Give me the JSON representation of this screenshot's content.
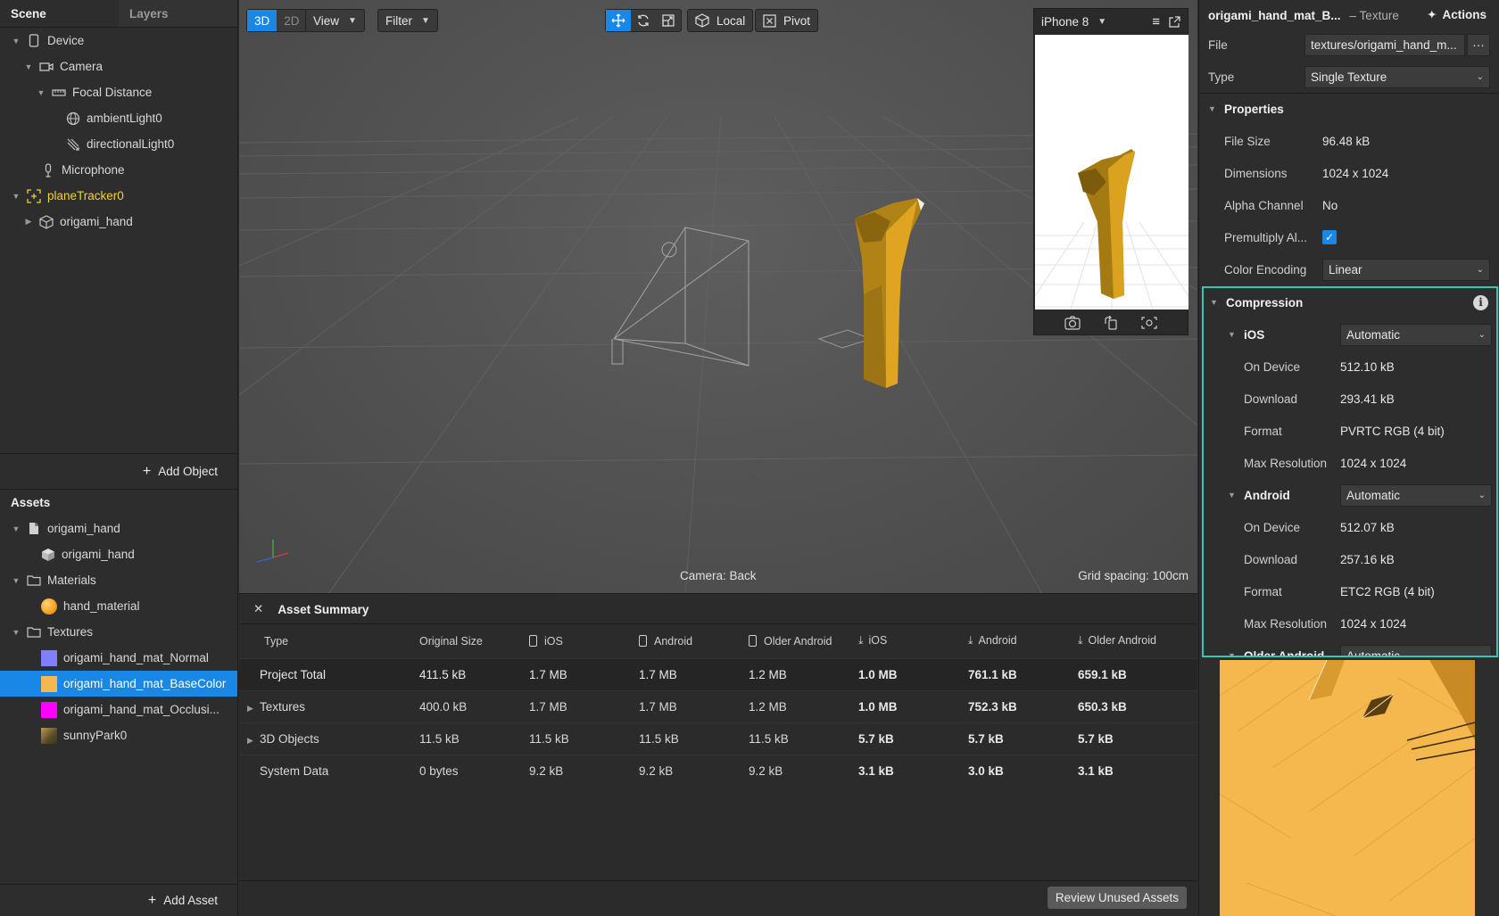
{
  "scene_tabs": {
    "scene": "Scene",
    "layers": "Layers"
  },
  "scene_tree": [
    {
      "label": "Device",
      "icon": "device-icon",
      "indent": 0,
      "expanded": true
    },
    {
      "label": "Camera",
      "icon": "camera-icon",
      "indent": 1,
      "expanded": true
    },
    {
      "label": "Focal Distance",
      "icon": "focal-distance-icon",
      "indent": 2,
      "expanded": true
    },
    {
      "label": "ambientLight0",
      "icon": "ambient-light-icon",
      "indent": 3
    },
    {
      "label": "directionalLight0",
      "icon": "directional-light-icon",
      "indent": 3
    },
    {
      "label": "Microphone",
      "icon": "microphone-icon",
      "indent": 1
    },
    {
      "label": "planeTracker0",
      "icon": "plane-tracker-icon",
      "indent": 0,
      "expanded": true,
      "highlight": "#f4d42a"
    },
    {
      "label": "origami_hand",
      "icon": "mesh-icon",
      "indent": 1,
      "collapsed": true
    }
  ],
  "add_object": "Add Object",
  "assets_title": "Assets",
  "assets_tree": [
    {
      "label": "origami_hand",
      "icon": "file-icon",
      "indent": 0,
      "expanded": true
    },
    {
      "label": "origami_hand",
      "icon": "mesh-icon",
      "indent": 1
    },
    {
      "label": "Materials",
      "icon": "folder-icon",
      "indent": 0,
      "expanded": true
    },
    {
      "label": "hand_material",
      "icon": "material-sphere-icon",
      "indent": 1,
      "color": "#f5a623"
    },
    {
      "label": "Textures",
      "icon": "folder-icon",
      "indent": 0,
      "expanded": true
    },
    {
      "label": "origami_hand_mat_Normal",
      "icon": "texture-swatch-icon",
      "indent": 1,
      "color": "#8080ff"
    },
    {
      "label": "origami_hand_mat_BaseColor",
      "icon": "texture-swatch-icon",
      "indent": 1,
      "color": "#f4b84f",
      "selected": true
    },
    {
      "label": "origami_hand_mat_Occlusi...",
      "icon": "texture-swatch-icon",
      "indent": 1,
      "color": "#ff00ff"
    },
    {
      "label": "sunnyPark0",
      "icon": "env-texture-icon",
      "indent": 1,
      "color": "#7a6a3a"
    }
  ],
  "add_asset": "Add Asset",
  "toolbar": {
    "mode_3d": "3D",
    "mode_2d": "2D",
    "view": "View",
    "filter": "Filter",
    "local": "Local",
    "pivot": "Pivot"
  },
  "viewport": {
    "camera_label": "Camera: Back",
    "grid_spacing": "Grid spacing: 100cm"
  },
  "preview": {
    "device": "iPhone 8"
  },
  "asset_summary": {
    "title": "Asset Summary",
    "columns": [
      "Type",
      "Original Size",
      "iOS",
      "Android",
      "Older Android",
      "iOS",
      "Android",
      "Older Android"
    ],
    "rows": [
      {
        "cells": [
          "Project Total",
          "411.5 kB",
          "1.7 MB",
          "1.7 MB",
          "1.2 MB",
          "1.0 MB",
          "761.1 kB",
          "659.1 kB"
        ],
        "total": true
      },
      {
        "cells": [
          "Textures",
          "400.0 kB",
          "1.7 MB",
          "1.7 MB",
          "1.2 MB",
          "1.0 MB",
          "752.3 kB",
          "650.3 kB"
        ],
        "expandable": true
      },
      {
        "cells": [
          "3D Objects",
          "11.5 kB",
          "11.5 kB",
          "11.5 kB",
          "11.5 kB",
          "5.7 kB",
          "5.7 kB",
          "5.7 kB"
        ],
        "expandable": true
      },
      {
        "cells": [
          "System Data",
          "0 bytes",
          "9.2 kB",
          "9.2 kB",
          "9.2 kB",
          "3.1 kB",
          "3.0 kB",
          "3.1 kB"
        ]
      }
    ],
    "review_button": "Review Unused Assets",
    "highlight_color": "#39d27a"
  },
  "inspector": {
    "title": "origami_hand_mat_B...",
    "subtitle": "– Texture",
    "actions": "Actions",
    "file_label": "File",
    "file_value": "textures/origami_hand_m...",
    "type_label": "Type",
    "type_value": "Single Texture",
    "properties_title": "Properties",
    "file_size_label": "File Size",
    "file_size": "96.48 kB",
    "dimensions_label": "Dimensions",
    "dimensions": "1024 x 1024",
    "alpha_label": "Alpha Channel",
    "alpha": "No",
    "premultiply_label": "Premultiply Al...",
    "premultiply_checked": true,
    "color_encoding_label": "Color Encoding",
    "color_encoding": "Linear",
    "compression_title": "Compression",
    "ios": {
      "label": "iOS",
      "setting": "Automatic",
      "on_device_label": "On Device",
      "on_device": "512.10 kB",
      "download_label": "Download",
      "download": "293.41 kB",
      "format_label": "Format",
      "format": "PVRTC RGB (4 bit)",
      "max_res_label": "Max Resolution",
      "max_res": "1024 x 1024"
    },
    "android": {
      "label": "Android",
      "setting": "Automatic",
      "on_device_label": "On Device",
      "on_device": "512.07 kB",
      "download_label": "Download",
      "download": "257.16 kB",
      "format_label": "Format",
      "format": "ETC2 RGB (4 bit)",
      "max_res_label": "Max Resolution",
      "max_res": "1024 x 1024"
    },
    "older_android": {
      "label": "Older Android",
      "setting": "Automatic"
    },
    "accent_color": "#35c6b7"
  }
}
